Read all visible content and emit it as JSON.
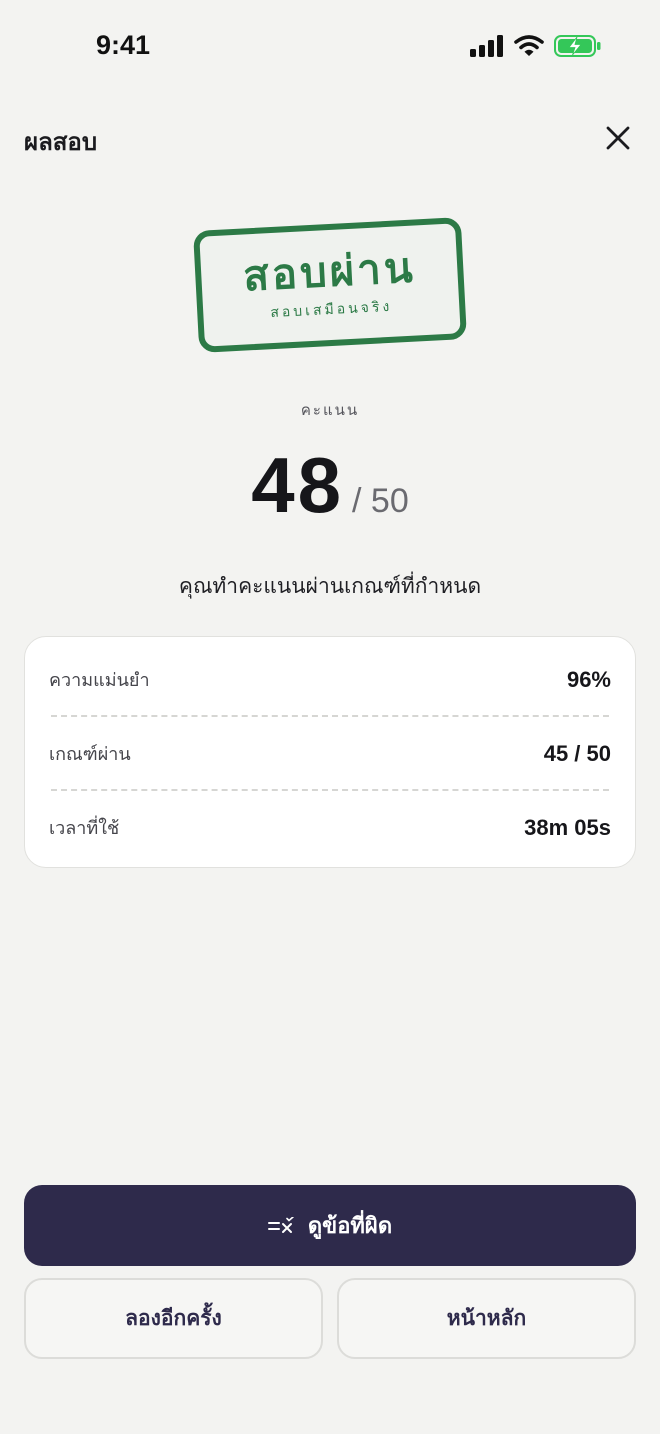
{
  "status_bar": {
    "time": "9:41",
    "icons": [
      "cellular-signal-icon",
      "wifi-icon",
      "battery-charging-icon"
    ]
  },
  "header": {
    "title": "ผลสอบ",
    "close_icon": "close-icon"
  },
  "stamp": {
    "title": "สอบผ่าน",
    "subtitle": "สอบเสมือนจริง"
  },
  "score": {
    "label": "คะแนน",
    "value": "48",
    "total": "/ 50"
  },
  "pass_message": "คุณทำคะแนนผ่านเกณฑ์ที่กำหนด",
  "stats": [
    {
      "label": "ความแม่นยำ",
      "value": "96%"
    },
    {
      "label": "เกณฑ์ผ่าน",
      "value": "45 / 50"
    },
    {
      "label": "เวลาที่ใช้",
      "value": "38m 05s"
    }
  ],
  "actions": {
    "review_mistakes": {
      "label": "ดูข้อที่ผิด",
      "icon": "review-mistakes-icon"
    },
    "retry": {
      "label": "ลองอีกครั้ง"
    },
    "home": {
      "label": "หน้าหลัก"
    }
  },
  "colors": {
    "background": "#f3f3f1",
    "stamp_green": "#2c7a46",
    "primary_button": "#2e2a4b",
    "battery_green": "#34c759"
  }
}
